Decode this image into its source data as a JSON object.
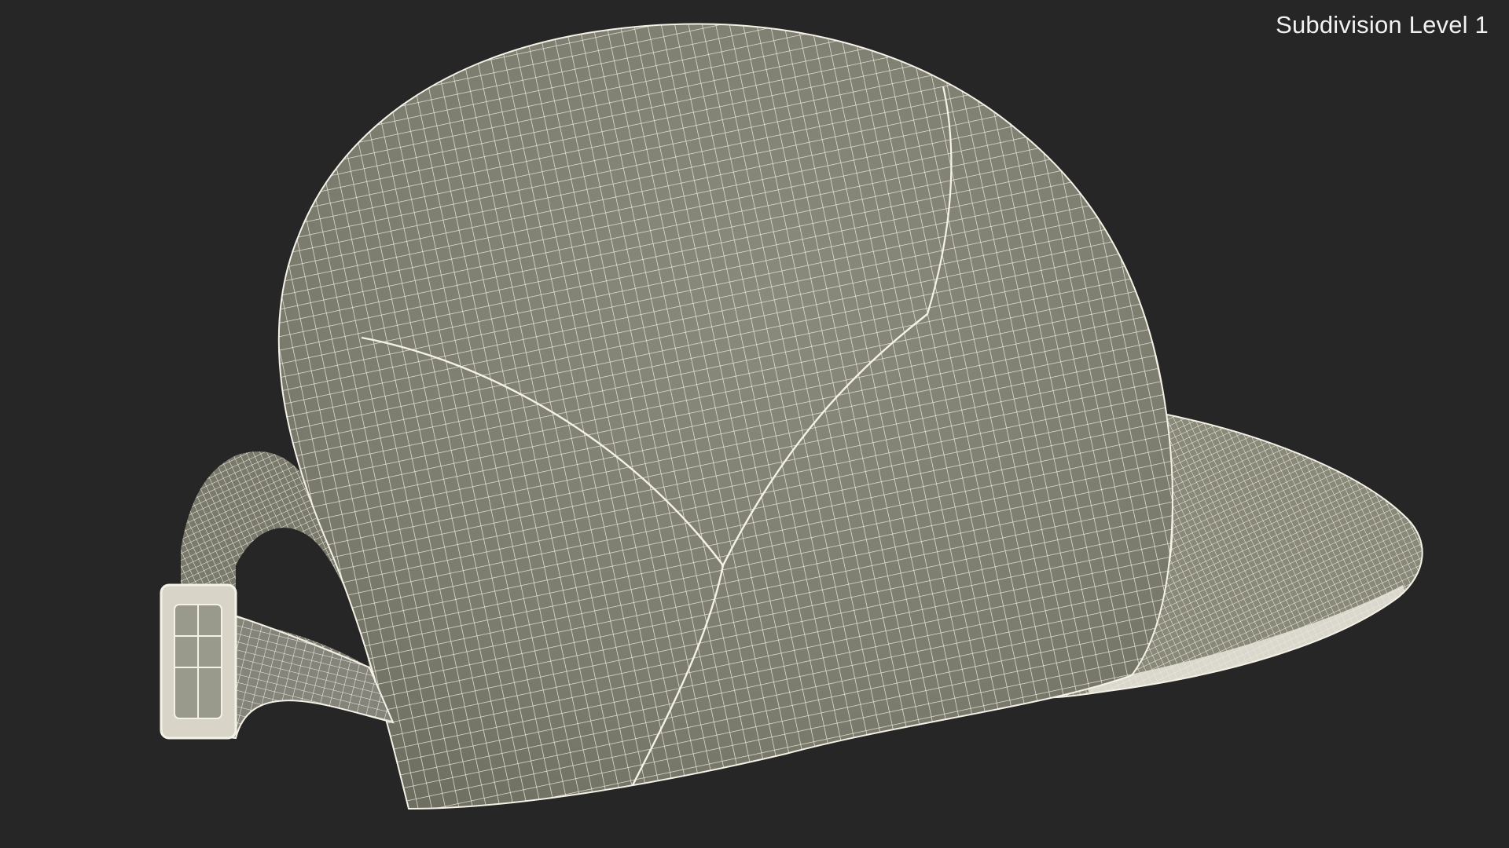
{
  "viewport": {
    "label": "Subdivision Level 1",
    "background_color": "#262626",
    "mesh_fill_color": "#7f7f70",
    "wire_color": "#f4f1e6"
  },
  "model": {
    "subject": "cap-icon",
    "shading": "wireframe-on-shaded"
  }
}
